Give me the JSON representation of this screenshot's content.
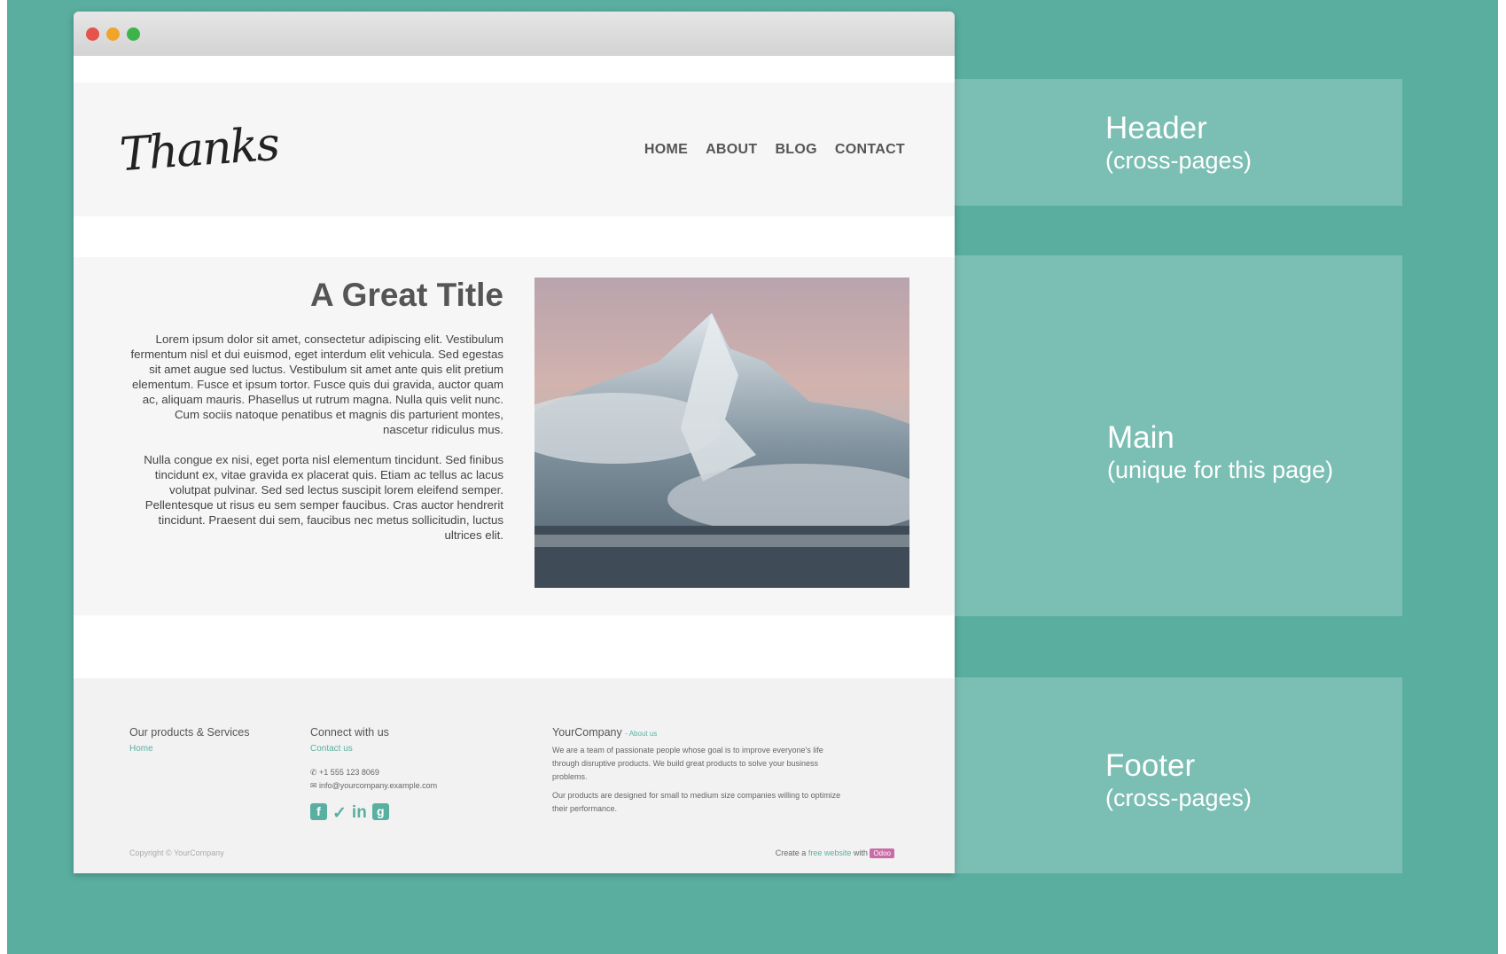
{
  "site": {
    "logo_text": "Thanks",
    "nav": [
      "HOME",
      "ABOUT",
      "BLOG",
      "CONTACT"
    ]
  },
  "main": {
    "title": "A Great Title",
    "paragraphs": [
      "Lorem ipsum dolor sit amet, consectetur adipiscing elit. Vestibulum fermentum nisl et dui euismod, eget interdum elit vehicula. Sed egestas sit amet augue sed luctus. Vestibulum sit amet ante quis elit pretium elementum. Fusce et ipsum tortor. Fusce quis dui gravida, auctor quam ac, aliquam mauris. Phasellus ut rutrum magna. Nulla quis velit nunc. Cum sociis natoque penatibus et magnis dis parturient montes, nascetur ridiculus mus.",
      "Nulla congue ex nisi, eget porta nisl elementum tincidunt. Sed finibus tincidunt ex, vitae gravida ex placerat quis. Etiam ac tellus ac lacus volutpat pulvinar. Sed sed lectus suscipit lorem eleifend semper. Pellentesque ut risus eu sem semper faucibus. Cras auctor hendrerit tincidunt. Praesent dui sem, faucibus nec metus sollicitudin, luctus ultrices elit."
    ]
  },
  "footer": {
    "col1": {
      "heading": "Our products & Services",
      "link": "Home"
    },
    "col2": {
      "heading": "Connect with us",
      "link": "Contact us",
      "phone": "+1 555 123 8069",
      "email": "info@yourcompany.example.com"
    },
    "col3": {
      "heading": "YourCompany",
      "link": "About us",
      "para1": "We are a team of passionate people whose goal is to improve everyone's life through disruptive products. We build great products to solve your business problems.",
      "para2": "Our products are designed for small to medium size companies willing to optimize their performance."
    },
    "copyright": "Copyright © YourCompany",
    "credit_prefix": "Create a",
    "credit_link": "free website",
    "credit_mid": "with",
    "credit_badge": "Odoo"
  },
  "labels": {
    "header": {
      "title": "Header",
      "sub": "(cross-pages)"
    },
    "main": {
      "title": "Main",
      "sub": "(unique for this page)"
    },
    "footer": {
      "title": "Footer",
      "sub": "(cross-pages)"
    }
  },
  "colors": {
    "background": "#5aaea0",
    "accent": "#59b0a1",
    "badge": "#c86ba6"
  }
}
